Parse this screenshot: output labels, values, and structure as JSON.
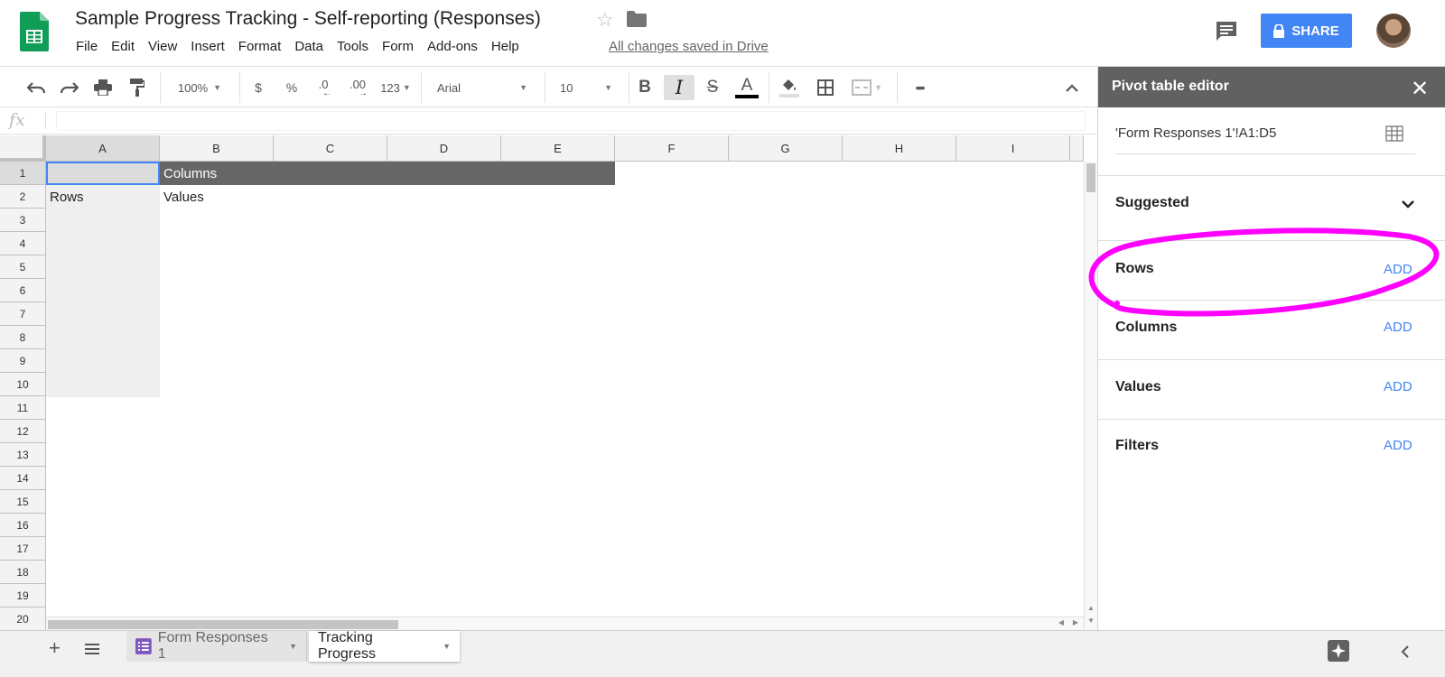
{
  "header": {
    "title": "Sample Progress Tracking - Self-reporting (Responses)",
    "menu": [
      "File",
      "Edit",
      "View",
      "Insert",
      "Format",
      "Data",
      "Tools",
      "Form",
      "Add-ons",
      "Help"
    ],
    "saved_status": "All changes saved in Drive",
    "share_label": "SHARE"
  },
  "toolbar": {
    "zoom": "100%",
    "currency": "$",
    "percent": "%",
    "decrease_decimal": ".0",
    "increase_decimal": ".00",
    "more_formats": "123",
    "font": "Arial",
    "font_size": "10",
    "bold": "B",
    "italic": "I",
    "strikethrough": "S",
    "text_color": "A",
    "more": "•••"
  },
  "formula_bar": {
    "fx": "fx",
    "value": ""
  },
  "grid": {
    "columns": [
      "A",
      "B",
      "C",
      "D",
      "E",
      "F",
      "G",
      "H",
      "I"
    ],
    "rows": [
      "1",
      "2",
      "3",
      "4",
      "5",
      "6",
      "7",
      "8",
      "9",
      "10",
      "11",
      "12",
      "13",
      "14",
      "15",
      "16",
      "17",
      "18",
      "19",
      "20"
    ],
    "cells": {
      "B1": "Columns",
      "A2": "Rows",
      "B2": "Values"
    }
  },
  "sheets": {
    "tabs": [
      "Form Responses 1",
      "Tracking Progress"
    ],
    "active": "Tracking Progress"
  },
  "panel": {
    "title": "Pivot table editor",
    "range": "'Form Responses 1'!A1:D5",
    "suggested": "Suggested",
    "sections": [
      {
        "label": "Rows",
        "add": "ADD"
      },
      {
        "label": "Columns",
        "add": "ADD"
      },
      {
        "label": "Values",
        "add": "ADD"
      },
      {
        "label": "Filters",
        "add": "ADD"
      }
    ]
  },
  "colors": {
    "accent": "#4285f4",
    "panel_header": "#616161",
    "columns_header_fill": "#666666",
    "annotation": "#ff00ff",
    "sheets_green": "#0f9d58"
  },
  "icons": {
    "app_logo": "google-sheets-icon",
    "star": "star-icon",
    "folder": "folder-icon",
    "comments": "comment-icon",
    "lock": "lock-icon",
    "undo": "undo-icon",
    "redo": "redo-icon",
    "print": "print-icon",
    "paint_format": "paint-format-icon",
    "fill_color": "fill-color-icon",
    "borders": "borders-icon",
    "merge": "merge-cells-icon",
    "collapse": "chevron-up-icon",
    "close": "close-icon",
    "select_range": "grid-icon",
    "suggested_toggle": "chevron-down-icon",
    "add_sheet": "plus-icon",
    "all_sheets": "list-icon",
    "explore": "explore-icon",
    "side_panel_toggle": "chevron-left-icon"
  }
}
